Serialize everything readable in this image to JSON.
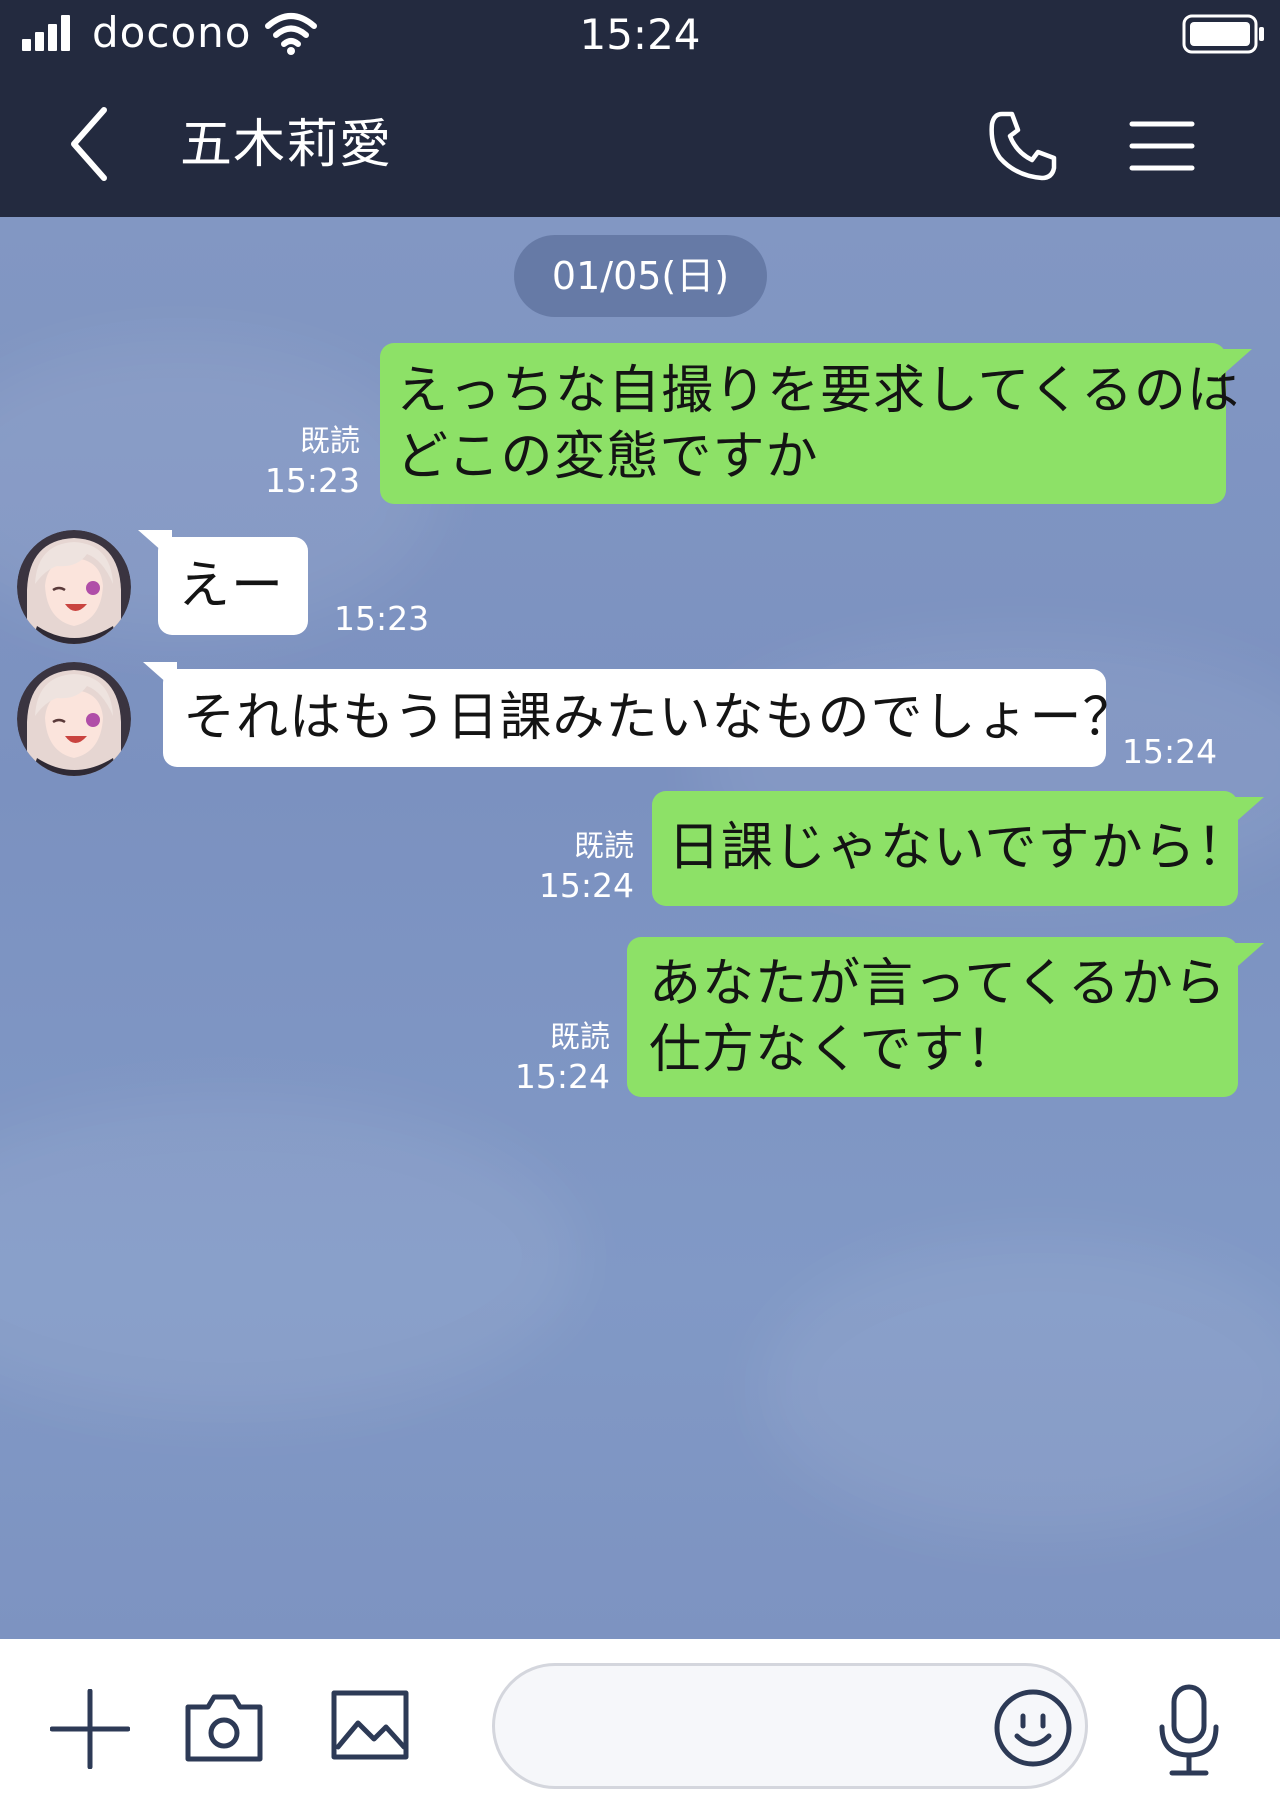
{
  "status_bar": {
    "carrier": "docono",
    "time": "15:24"
  },
  "header": {
    "contact_name": "五木莉愛"
  },
  "chat": {
    "date_label": "01/05(日)",
    "messages": [
      {
        "direction": "outgoing",
        "lines": [
          "えっちな自撮りを要求してくるのは",
          "どこの変態ですか"
        ],
        "read": "既読",
        "time": "15:23"
      },
      {
        "direction": "incoming",
        "lines": [
          "えー"
        ],
        "time": "15:23"
      },
      {
        "direction": "incoming",
        "lines": [
          "それはもう日課みたいなものでしょー？"
        ],
        "time": "15:24"
      },
      {
        "direction": "outgoing",
        "lines": [
          "日課じゃないですから！"
        ],
        "read": "既読",
        "time": "15:24"
      },
      {
        "direction": "outgoing",
        "lines": [
          "あなたが言ってくるから",
          "仕方なくです！"
        ],
        "read": "既読",
        "time": "15:24"
      }
    ]
  },
  "input_bar": {
    "placeholder": "",
    "icons": [
      "plus-icon",
      "camera-icon",
      "image-icon",
      "emoji-icon",
      "microphone-icon"
    ]
  },
  "colors": {
    "header_bg": "#232a3f",
    "chat_bg": "#8096c4",
    "outgoing_bubble": "#8de167",
    "incoming_bubble": "#ffffff",
    "date_pill": "#667aa6",
    "icon_stroke": "#2d3a56"
  }
}
